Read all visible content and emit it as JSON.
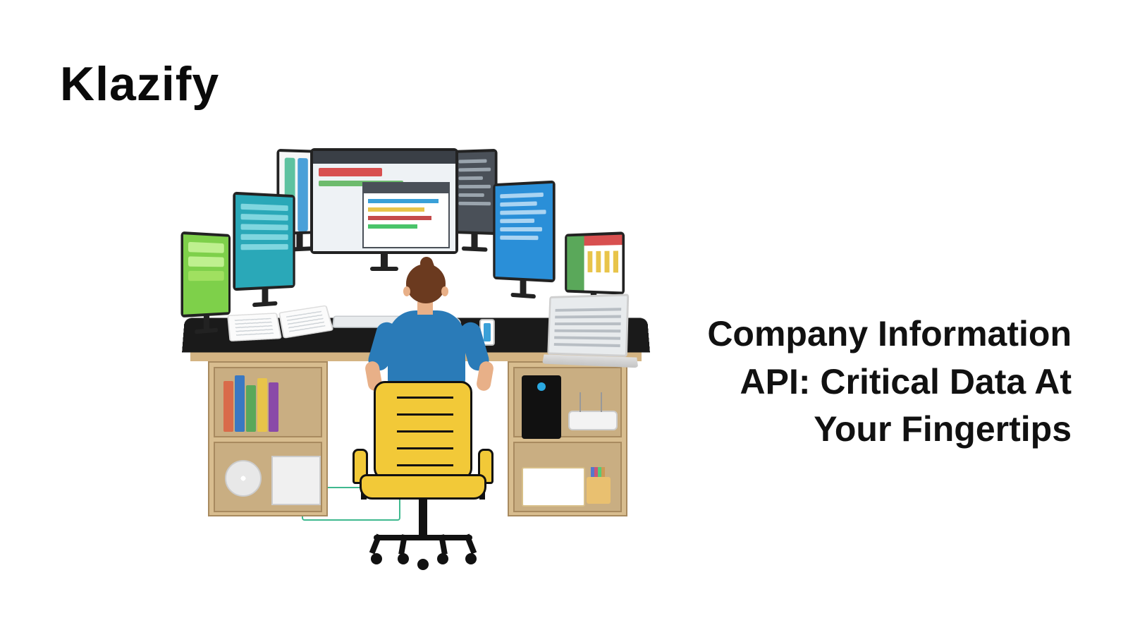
{
  "brand": "Klazify",
  "headline": "Company Information API: Critical Data At Your Fingertips"
}
